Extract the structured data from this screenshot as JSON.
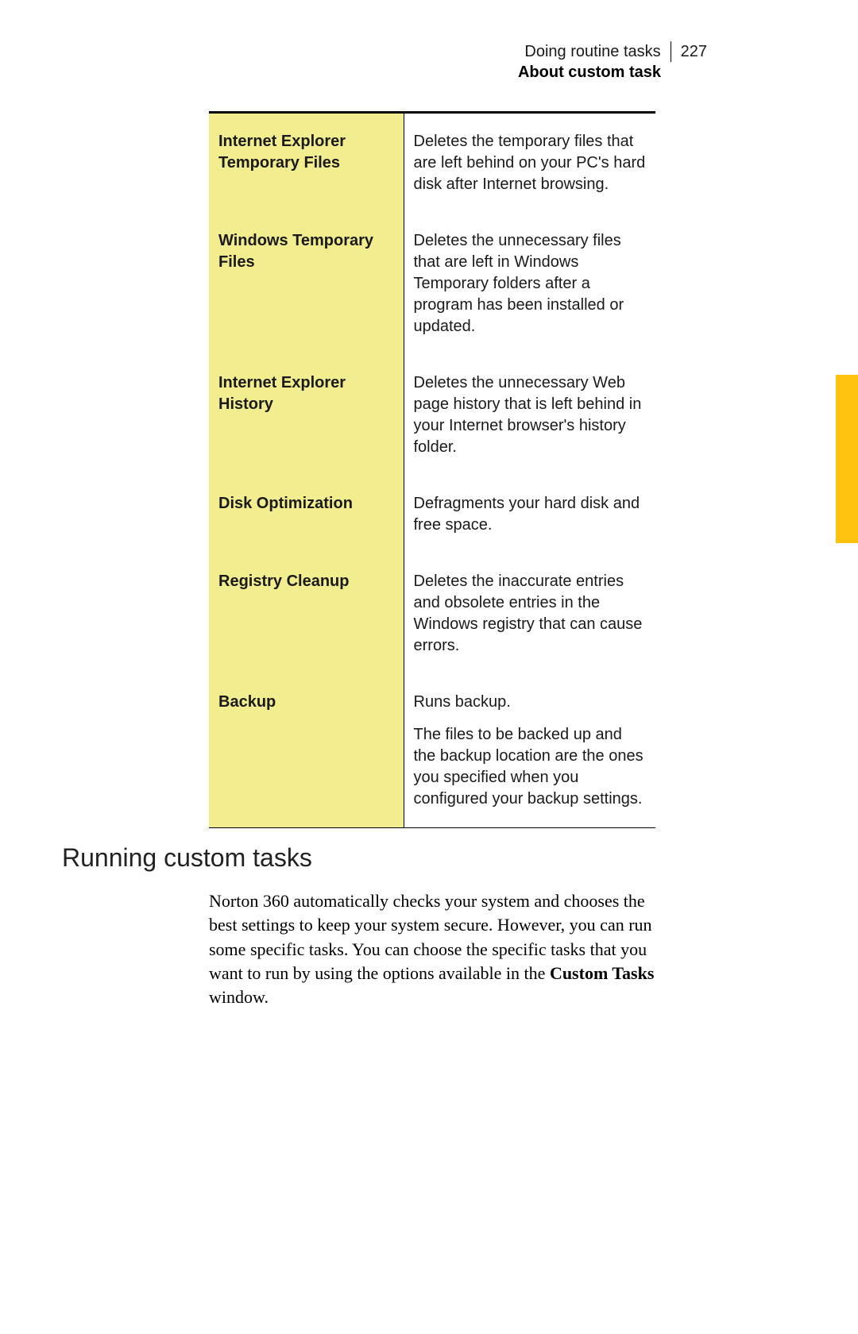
{
  "header": {
    "chapter": "Doing routine tasks",
    "pageNumber": "227",
    "subtitle": "About custom task"
  },
  "table": {
    "rows": [
      {
        "label": "Internet Explorer Temporary Files",
        "desc": [
          "Deletes the temporary files that are left behind on your PC's hard disk after Internet browsing."
        ]
      },
      {
        "label": "Windows Temporary Files",
        "desc": [
          "Deletes the unnecessary files that are left in Windows Temporary folders after a program has been installed or updated."
        ]
      },
      {
        "label": "Internet Explorer History",
        "desc": [
          "Deletes the unnecessary Web page history that is left behind in your Internet browser's history folder."
        ]
      },
      {
        "label": "Disk Optimization",
        "desc": [
          "Defragments your hard disk and free space."
        ]
      },
      {
        "label": "Registry Cleanup",
        "desc": [
          "Deletes the inaccurate entries and obsolete entries in the Windows registry that can cause errors."
        ]
      },
      {
        "label": "Backup",
        "desc": [
          "Runs backup.",
          "The files to be backed up and the backup location are the ones you specified when you configured your backup settings."
        ]
      }
    ]
  },
  "section": {
    "heading": "Running custom tasks",
    "body_prefix": "Norton 360 automatically checks your system and chooses the best settings to keep your system secure. However, you can run some specific tasks. You can choose the specific tasks that you want to run by using the options available in the ",
    "body_bold": "Custom Tasks",
    "body_suffix": " window."
  }
}
